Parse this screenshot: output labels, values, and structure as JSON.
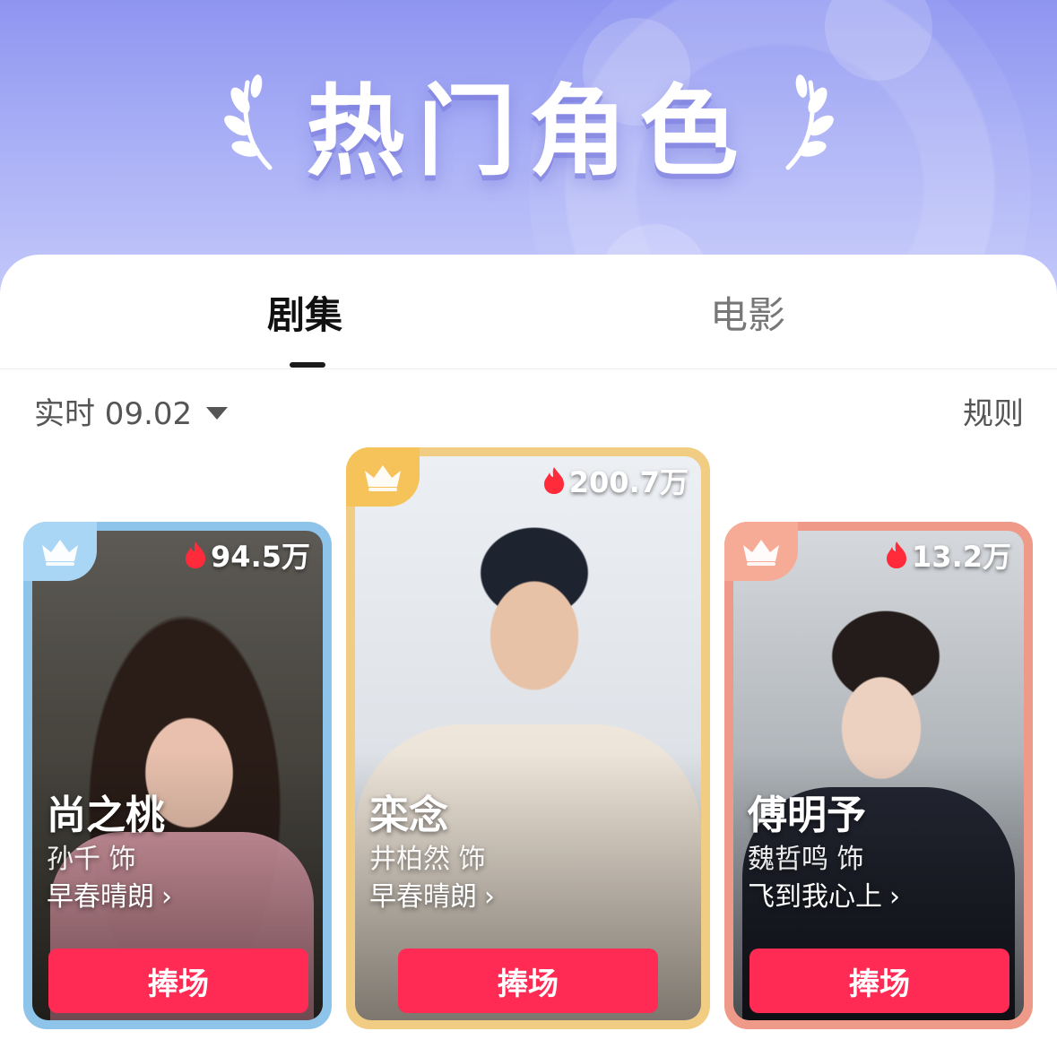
{
  "header": {
    "title": "热门角色"
  },
  "tabs": [
    {
      "label": "剧集",
      "active": true
    },
    {
      "label": "电影",
      "active": false
    }
  ],
  "filter": {
    "date_label": "实时 09.02",
    "rules_label": "规则"
  },
  "cards": [
    {
      "rank": 2,
      "heat": "94.5万",
      "role": "尚之桃",
      "actor": "孙千 饰",
      "show": "早春晴朗",
      "button": "捧场",
      "frame_color": "#8ec3ea",
      "crown_icon": "crown-icon"
    },
    {
      "rank": 1,
      "heat": "200.7万",
      "role": "栾念",
      "actor": "井柏然 饰",
      "show": "早春晴朗",
      "button": "捧场",
      "frame_color": "#f0cd82",
      "crown_icon": "crown-icon"
    },
    {
      "rank": 3,
      "heat": "13.2万",
      "role": "傅明予",
      "actor": "魏哲鸣 饰",
      "show": "飞到我心上",
      "button": "捧场",
      "frame_color": "#ef9a88",
      "crown_icon": "crown-icon"
    }
  ],
  "colors": {
    "accent": "#ff2b55",
    "banner": "#a8aef5"
  }
}
